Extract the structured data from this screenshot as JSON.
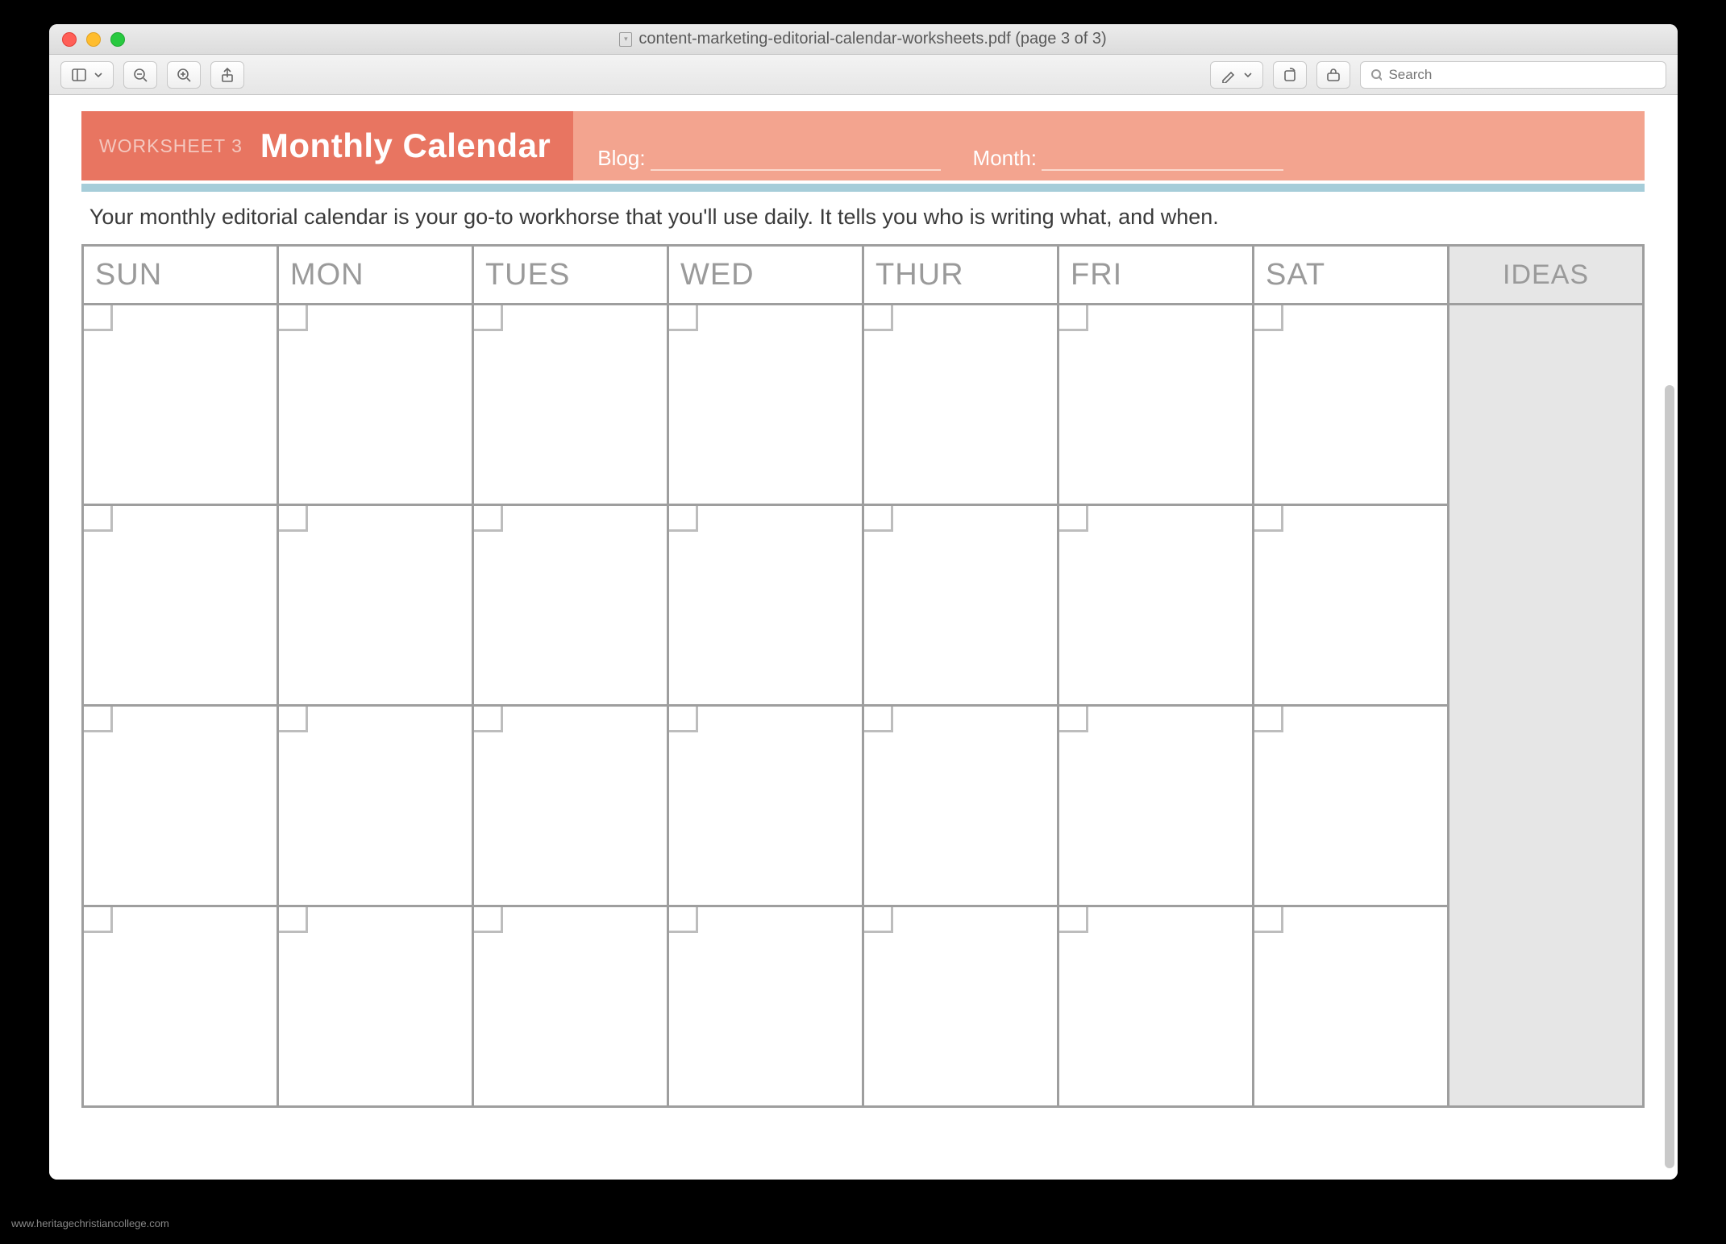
{
  "window": {
    "title": "content-marketing-editorial-calendar-worksheets.pdf (page 3 of 3)"
  },
  "toolbar": {
    "search_placeholder": "Search"
  },
  "worksheet": {
    "label": "WORKSHEET 3",
    "title": "Monthly Calendar",
    "blog_label": "Blog:",
    "month_label": "Month:",
    "intro": "Your monthly editorial calendar is your go-to workhorse that you'll use daily. It tells you who is writing what, and when.",
    "columns": [
      "SUN",
      "MON",
      "TUES",
      "WED",
      "THUR",
      "FRI",
      "SAT",
      "IDEAS"
    ],
    "week_rows": 4
  },
  "watermark": "www.heritagechristiancollege.com"
}
